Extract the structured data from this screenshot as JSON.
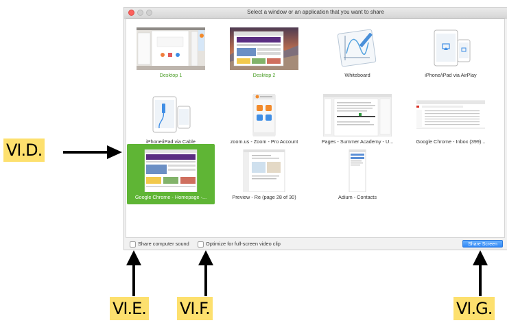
{
  "window": {
    "title": "Select a window or an application that you want to share"
  },
  "tiles": [
    {
      "label": "Desktop 1"
    },
    {
      "label": "Desktop 2"
    },
    {
      "label": "Whiteboard"
    },
    {
      "label": "iPhone/iPad via AirPlay"
    },
    {
      "label": "iPhone/iPad via Cable"
    },
    {
      "label": "zoom.us - Zoom - Pro Account"
    },
    {
      "label": "Pages - Summer Academy - U..."
    },
    {
      "label": "Google Chrome - Inbox (399)..."
    },
    {
      "label": "Google Chrome - Homepage -..."
    },
    {
      "label": "Preview - Re (page 28 of 30)"
    },
    {
      "label": "Adium - Contacts"
    }
  ],
  "footer": {
    "share_sound_label": "Share computer sound",
    "optimize_label": "Optimize for full-screen video clip",
    "share_button": "Share Screen"
  },
  "callouts": {
    "d": "VI.D.",
    "e": "VI.E.",
    "f": "VI.F.",
    "g": "VI.G."
  },
  "colors": {
    "selected_tile": "#5fb535",
    "desktop_label": "#4a9d26",
    "share_button": "#2f87f6",
    "callout_bg": "#fde06e"
  }
}
